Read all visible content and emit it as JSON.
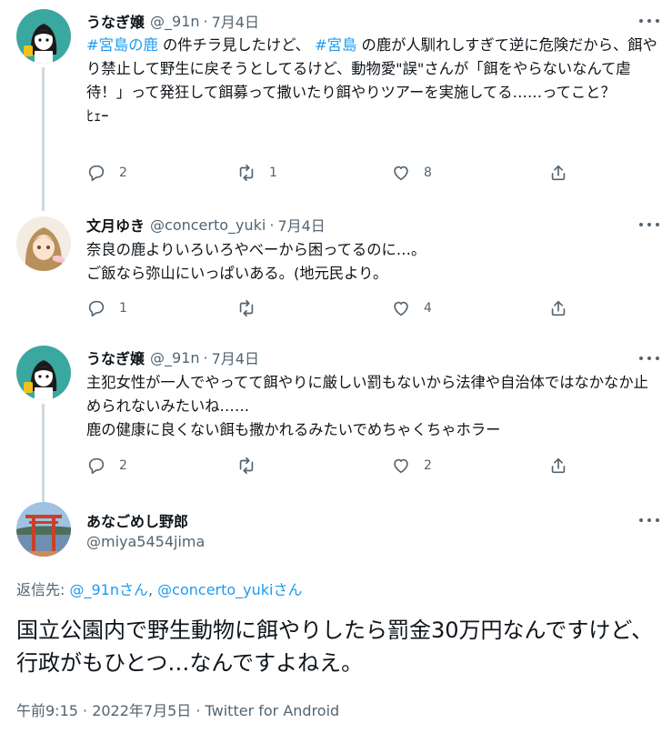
{
  "colors": {
    "link": "#1d9bf0",
    "muted": "#536471",
    "text": "#0f1419",
    "line": "#cfd9de"
  },
  "tweets": [
    {
      "name": "うなぎ嬢",
      "handle": "@_91n",
      "sep": "·",
      "date": "7月4日",
      "avatar_icon": "anime-girl-avatar",
      "text_parts": [
        {
          "t": "#宮島の鹿",
          "tag": true
        },
        {
          "t": " の件チラ見したけど、 ",
          "tag": false
        },
        {
          "t": "#宮島",
          "tag": true
        },
        {
          "t": " の鹿が人馴れしすぎて逆に危険だから、餌やり禁止して野生に戻そうとしてるけど、動物愛\"誤\"さんが「餌をやらないなんて虐待！」って発狂して餌募って撒いたり餌やりツアーを実施してる……ってこと？\nﾋｪｰ",
          "tag": false
        }
      ],
      "replies": "2",
      "retweets": "1",
      "likes": "8"
    },
    {
      "name": "文月ゆき",
      "handle": "@concerto_yuki",
      "sep": "·",
      "date": "7月4日",
      "avatar_icon": "brown-hair-girl-avatar",
      "text_parts": [
        {
          "t": "奈良の鹿よりいろいろやべーから困ってるのに…。\nご飯なら弥山にいっぱいある。(地元民より。",
          "tag": false
        }
      ],
      "replies": "1",
      "retweets": "",
      "likes": "4"
    },
    {
      "name": "うなぎ嬢",
      "handle": "@_91n",
      "sep": "·",
      "date": "7月4日",
      "avatar_icon": "anime-girl-avatar",
      "text_parts": [
        {
          "t": "主犯女性が一人でやってて餌やりに厳しい罰もないから法律や自治体ではなかなか止められないみたいね……\n鹿の健康に良くない餌も撒かれるみたいでめちゃくちゃホラー",
          "tag": false
        }
      ],
      "replies": "2",
      "retweets": "",
      "likes": "2"
    }
  ],
  "main": {
    "name": "あなごめし野郎",
    "handle": "@miya5454jima",
    "avatar_icon": "torii-gate-avatar",
    "replying_label": "返信先: ",
    "mentions": [
      "@_91nさん",
      "@concerto_yukiさん"
    ],
    "mention_sep": ", ",
    "text": "国立公園内で野生動物に餌やりしたら罰金30万円なんですけど、行政がもひとつ…なんですよねえ。",
    "timestamp": "午前9:15 · 2022年7月5日 · Twitter for Android"
  }
}
